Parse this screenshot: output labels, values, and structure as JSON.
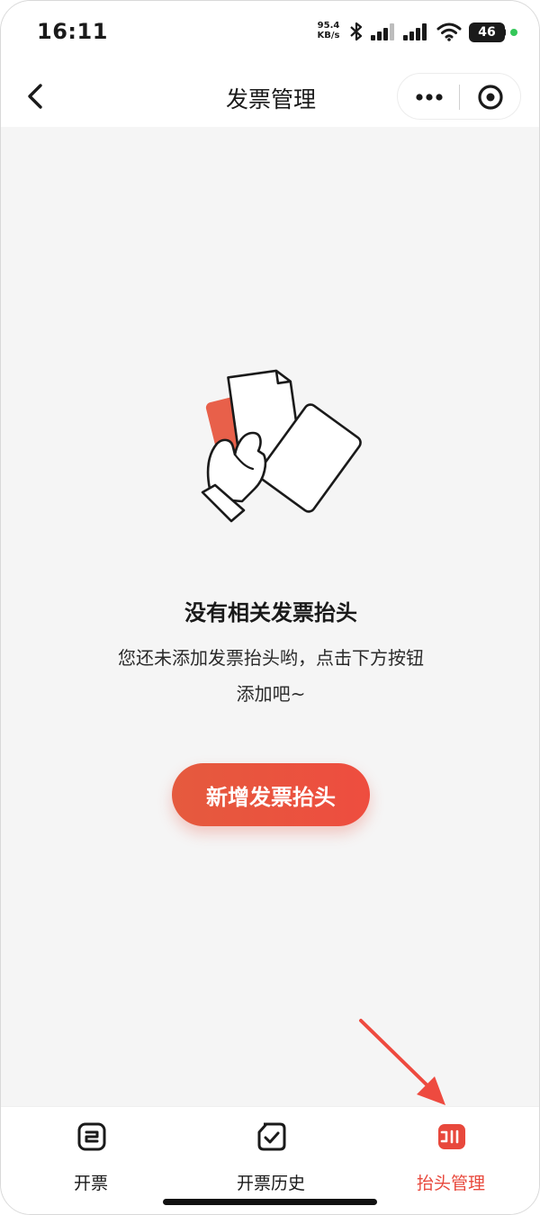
{
  "status_bar": {
    "time": "16:11",
    "net_speed_value": "95.4",
    "net_speed_unit": "KB/s",
    "battery": "46"
  },
  "nav": {
    "title": "发票管理",
    "back_icon": "chevron-left-icon",
    "more_icon": "more-dots-icon",
    "close_icon": "close-circle-icon"
  },
  "empty_state": {
    "illustration": "hand-holding-invoices-illustration",
    "title": "没有相关发票抬头",
    "desc_line1": "您还未添加发票抬头哟，点击下方按钮",
    "desc_line2": "添加吧~",
    "button_label": "新增发票抬头"
  },
  "tabs": [
    {
      "label": "开票",
      "icon": "invoice-icon",
      "active": false
    },
    {
      "label": "开票历史",
      "icon": "history-check-icon",
      "active": false
    },
    {
      "label": "抬头管理",
      "icon": "header-manage-icon",
      "active": true
    }
  ],
  "colors": {
    "accent": "#e8483c",
    "button_start": "#e55a3e",
    "button_end": "#ee4d3f",
    "background": "#f5f5f5"
  }
}
